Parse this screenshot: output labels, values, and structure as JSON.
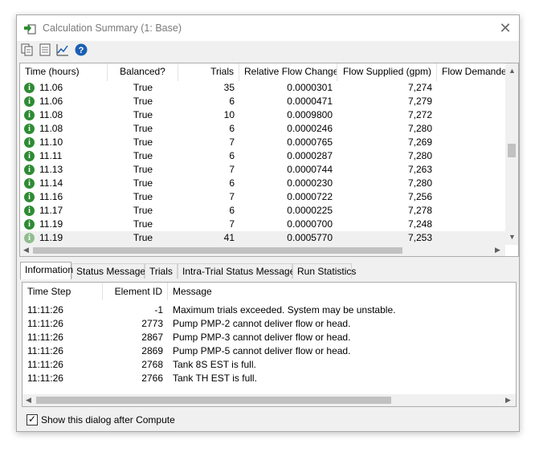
{
  "window": {
    "title": "Calculation Summary (1: Base)"
  },
  "grid": {
    "columns": [
      "Time (hours)",
      "Balanced?",
      "Trials",
      "Relative Flow Change",
      "Flow Supplied (gpm)",
      "Flow Demanded"
    ],
    "rows": [
      {
        "time": "11.06",
        "balanced": "True",
        "trials": "35",
        "rfc": "0.0000301",
        "supplied": "7,274"
      },
      {
        "time": "11.06",
        "balanced": "True",
        "trials": "6",
        "rfc": "0.0000471",
        "supplied": "7,279"
      },
      {
        "time": "11.08",
        "balanced": "True",
        "trials": "10",
        "rfc": "0.0009800",
        "supplied": "7,272"
      },
      {
        "time": "11.08",
        "balanced": "True",
        "trials": "6",
        "rfc": "0.0000246",
        "supplied": "7,280"
      },
      {
        "time": "11.10",
        "balanced": "True",
        "trials": "7",
        "rfc": "0.0000765",
        "supplied": "7,269"
      },
      {
        "time": "11.11",
        "balanced": "True",
        "trials": "6",
        "rfc": "0.0000287",
        "supplied": "7,280"
      },
      {
        "time": "11.13",
        "balanced": "True",
        "trials": "7",
        "rfc": "0.0000744",
        "supplied": "7,263"
      },
      {
        "time": "11.14",
        "balanced": "True",
        "trials": "6",
        "rfc": "0.0000230",
        "supplied": "7,280"
      },
      {
        "time": "11.16",
        "balanced": "True",
        "trials": "7",
        "rfc": "0.0000722",
        "supplied": "7,256"
      },
      {
        "time": "11.17",
        "balanced": "True",
        "trials": "6",
        "rfc": "0.0000225",
        "supplied": "7,278"
      },
      {
        "time": "11.19",
        "balanced": "True",
        "trials": "7",
        "rfc": "0.0000700",
        "supplied": "7,248"
      },
      {
        "time": "11.19",
        "balanced": "True",
        "trials": "41",
        "rfc": "0.0005770",
        "supplied": "7,253"
      }
    ]
  },
  "tabs": [
    "Information",
    "Status Messages",
    "Trials",
    "Intra-Trial Status Messages",
    "Run Statistics"
  ],
  "log": {
    "columns": [
      "Time Step",
      "Element ID",
      "Message"
    ],
    "rows": [
      {
        "step": "11:11:26",
        "id": "-1",
        "msg": "Maximum trials exceeded. System may be unstable."
      },
      {
        "step": "11:11:26",
        "id": "2773",
        "msg": "Pump PMP-2 cannot deliver flow or head."
      },
      {
        "step": "11:11:26",
        "id": "2867",
        "msg": "Pump PMP-3 cannot deliver flow or head."
      },
      {
        "step": "11:11:26",
        "id": "2869",
        "msg": "Pump PMP-5 cannot deliver flow or head."
      },
      {
        "step": "11:11:26",
        "id": "2768",
        "msg": "Tank 8S EST is full."
      },
      {
        "step": "11:11:26",
        "id": "2766",
        "msg": "Tank TH EST is full."
      }
    ]
  },
  "footer": {
    "checkbox_label": "Show this dialog after Compute",
    "checked": true
  },
  "icons": {
    "title": "app-calc-icon",
    "toolbar": [
      "copy-icon",
      "report-icon",
      "graph-icon",
      "help-icon"
    ],
    "row": "info-icon"
  },
  "colors": {
    "info_green": "#2e8b34",
    "help_blue": "#1a5fb4"
  }
}
